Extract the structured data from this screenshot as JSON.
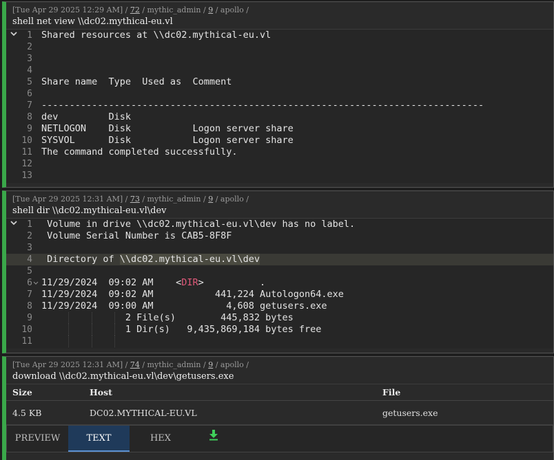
{
  "tasks": [
    {
      "meta": {
        "date": "[Tue Apr 29 2025 12:29 AM]",
        "task_id": "72",
        "user": "mythic_admin",
        "callback": "9",
        "host": "apollo"
      },
      "command": "shell net view \\\\dc02.mythical-eu.vl",
      "lines": [
        {
          "n": "1",
          "text": "Shared resources at \\\\dc02.mythical-eu.vl"
        },
        {
          "n": "2",
          "text": ""
        },
        {
          "n": "3",
          "text": ""
        },
        {
          "n": "4",
          "text": ""
        },
        {
          "n": "5",
          "text": "Share name  Type  Used as  Comment"
        },
        {
          "n": "6",
          "text": ""
        },
        {
          "n": "7",
          "text": "-------------------------------------------------------------------------------"
        },
        {
          "n": "8",
          "text": "dev         Disk"
        },
        {
          "n": "9",
          "text": "NETLOGON    Disk           Logon server share"
        },
        {
          "n": "10",
          "text": "SYSVOL      Disk           Logon server share"
        },
        {
          "n": "11",
          "text": "The command completed successfully."
        },
        {
          "n": "12",
          "text": ""
        },
        {
          "n": "13",
          "text": ""
        }
      ]
    },
    {
      "meta": {
        "date": "[Tue Apr 29 2025 12:31 AM]",
        "task_id": "73",
        "user": "mythic_admin",
        "callback": "9",
        "host": "apollo"
      },
      "command": "shell dir \\\\dc02.mythical-eu.vl\\dev",
      "lines": [
        {
          "n": "1",
          "text": " Volume in drive \\\\dc02.mythical-eu.vl\\dev has no label."
        },
        {
          "n": "2",
          "text": " Volume Serial Number is CAB5-8F8F"
        },
        {
          "n": "3",
          "text": ""
        },
        {
          "n": "4",
          "pre": " Directory of ",
          "sel": "\\\\dc02.mythical-eu.vl\\dev"
        },
        {
          "n": "5",
          "text": ""
        },
        {
          "n": "6",
          "pre": "11/29/2024  09:02 AM    <",
          "dirtag": "DIR",
          "post": ">          ."
        },
        {
          "n": "7",
          "text": "11/29/2024  09:02 AM           441,224 Autologon64.exe"
        },
        {
          "n": "8",
          "text": "11/29/2024  09:00 AM             4,608 getusers.exe"
        },
        {
          "n": "9",
          "text": "               2 File(s)        445,832 bytes"
        },
        {
          "n": "10",
          "text": "               1 Dir(s)   9,435,869,184 bytes free"
        },
        {
          "n": "11",
          "text": ""
        }
      ]
    },
    {
      "meta": {
        "date": "[Tue Apr 29 2025 12:31 AM]",
        "task_id": "74",
        "user": "mythic_admin",
        "callback": "9",
        "host": "apollo"
      },
      "command": "download \\\\dc02.mythical-eu.vl\\dev\\getusers.exe",
      "table": {
        "headers": [
          "Size",
          "Host",
          "File"
        ],
        "row": [
          "4.5 KB",
          "DC02.MYTHICAL-EU.VL",
          "getusers.exe"
        ]
      },
      "tabs": [
        "PREVIEW",
        "TEXT",
        "HEX"
      ],
      "active_tab": "TEXT"
    }
  ],
  "colors": {
    "accent": "#3aa84a",
    "active_tab": "#1f3a5a",
    "dir_tag": "#e05a7a",
    "download_icon": "#3fcf5a"
  },
  "icons": {
    "fold": "chevron-down-icon",
    "download": "download-icon"
  }
}
